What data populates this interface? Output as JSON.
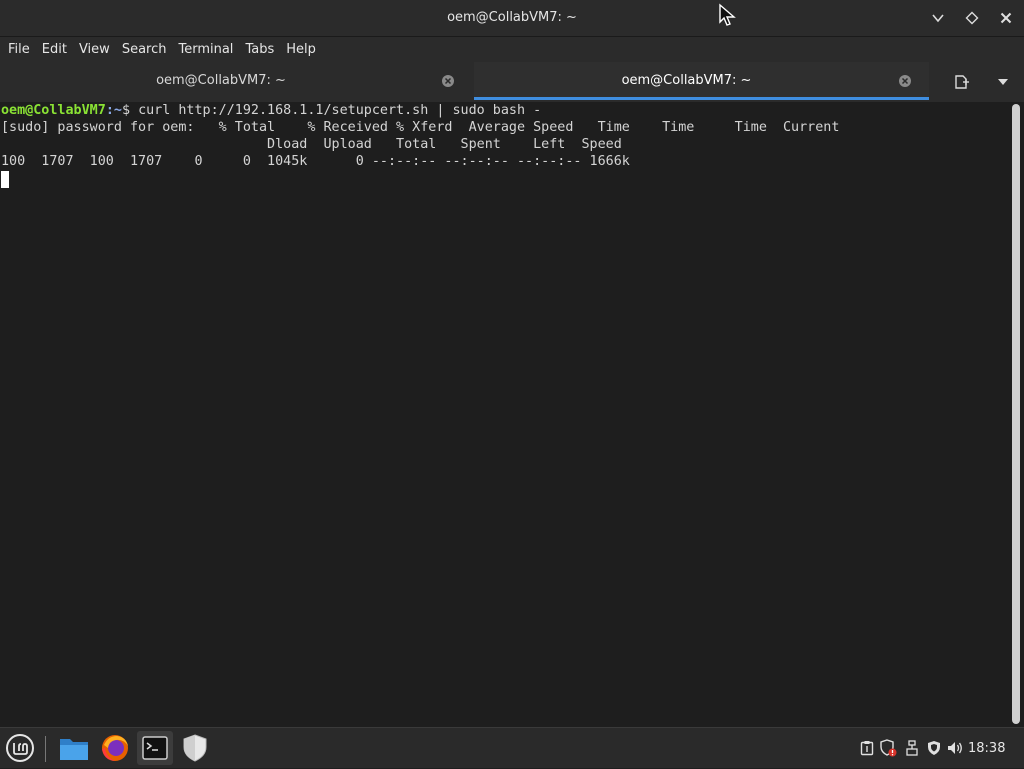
{
  "window": {
    "title": "oem@CollabVM7: ~"
  },
  "menubar": {
    "items": [
      {
        "label": "File"
      },
      {
        "label": "Edit"
      },
      {
        "label": "View"
      },
      {
        "label": "Search"
      },
      {
        "label": "Terminal"
      },
      {
        "label": "Tabs"
      },
      {
        "label": "Help"
      }
    ]
  },
  "tabs": [
    {
      "label": "oem@CollabVM7: ~",
      "active": false
    },
    {
      "label": "oem@CollabVM7: ~",
      "active": true
    }
  ],
  "terminal": {
    "prompt_user": "oem@CollabVM7",
    "prompt_path": ":~",
    "prompt_symbol": "$ ",
    "command": "curl http://192.168.1.1/setupcert.sh | sudo bash -",
    "lines": [
      "[sudo] password for oem:   % Total    % Received % Xferd  Average Speed   Time    Time     Time  Current",
      "                                 Dload  Upload   Total   Spent    Left  Speed",
      "100  1707  100  1707    0     0  1045k      0 --:--:-- --:--:-- --:--:-- 1666k"
    ]
  },
  "taskbar": {
    "clock": "18:38",
    "apps": [
      {
        "name": "menu-icon"
      },
      {
        "name": "files-icon"
      },
      {
        "name": "firefox-icon"
      },
      {
        "name": "terminal-icon"
      },
      {
        "name": "shield-icon"
      }
    ],
    "tray": [
      {
        "name": "clipboard-icon"
      },
      {
        "name": "update-shield-icon"
      },
      {
        "name": "network-icon"
      },
      {
        "name": "security-icon"
      },
      {
        "name": "volume-icon"
      }
    ]
  },
  "colors": {
    "prompt_user": "#8ae234",
    "prompt_path": "#8aa8e6",
    "tab_active_accent": "#3f8ee0",
    "terminal_bg": "#1e1e1e"
  }
}
